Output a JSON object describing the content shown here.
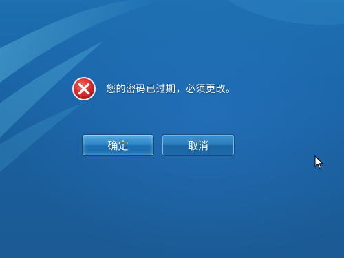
{
  "dialog": {
    "message": "您的密码已过期，必须更改。",
    "icon": "error-icon",
    "ok_label": "确定",
    "cancel_label": "取消"
  },
  "colors": {
    "background": "#1a64a6",
    "error_red": "#d92b2b",
    "text": "#ffffff"
  }
}
